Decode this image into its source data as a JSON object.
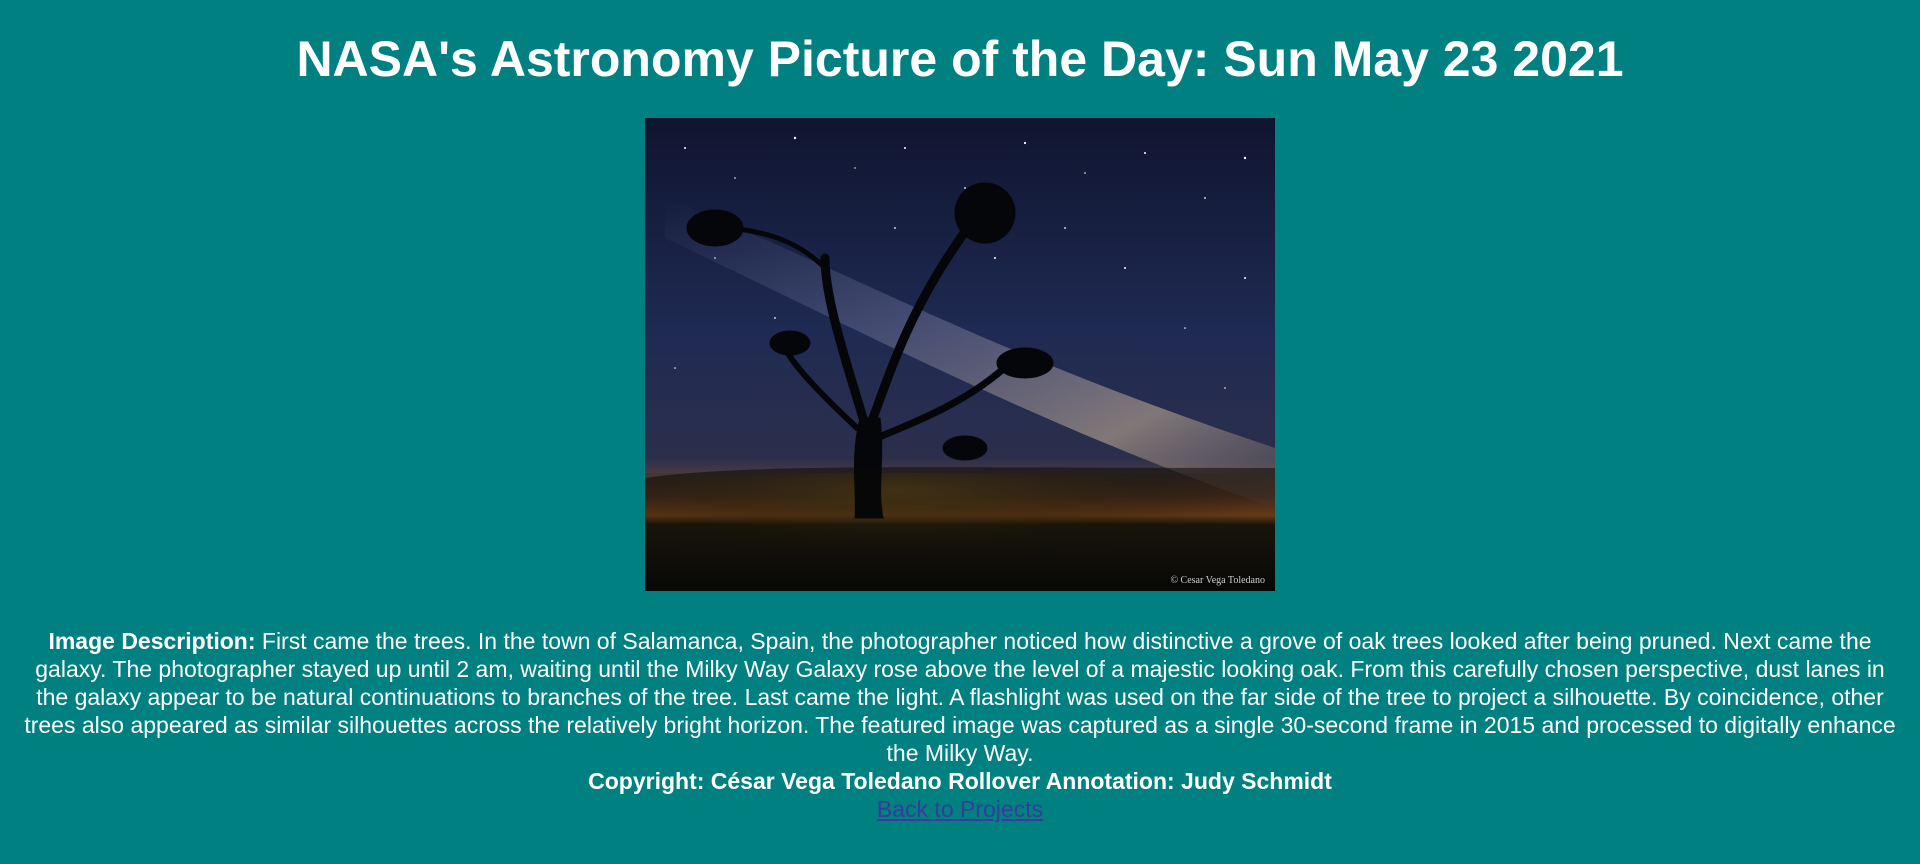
{
  "header": {
    "title": "NASA's Astronomy Picture of the Day: Sun May 23 2021"
  },
  "photo": {
    "watermark": "© Cesar Vega Toledano",
    "colors": {
      "sky_top": "#141c3a",
      "sky_mid": "#27305a",
      "horizon": "#d8762a",
      "ground": "#2a2410",
      "silhouette": "#05060a"
    }
  },
  "description": {
    "label": "Image Description:",
    "text": " First came the trees. In the town of Salamanca, Spain, the photographer noticed how distinctive a grove of oak trees looked after being pruned. Next came the galaxy. The photographer stayed up until 2 am, waiting until the Milky Way Galaxy rose above the level of a majestic looking oak. From this carefully chosen perspective, dust lanes in the galaxy appear to be natural continuations to branches of the tree. Last came the light. A flashlight was used on the far side of the tree to project a silhouette. By coincidence, other trees also appeared as similar silhouettes across the relatively bright horizon. The featured image was captured as a single 30-second frame in 2015 and processed to digitally enhance the Milky Way."
  },
  "credits": {
    "text": "Copyright: César Vega Toledano Rollover Annotation: Judy Schmidt"
  },
  "nav": {
    "back_label": "Back to Projects"
  },
  "theme": {
    "background": "#008080",
    "text": "#ffffff",
    "link": "#3a3a9c"
  }
}
